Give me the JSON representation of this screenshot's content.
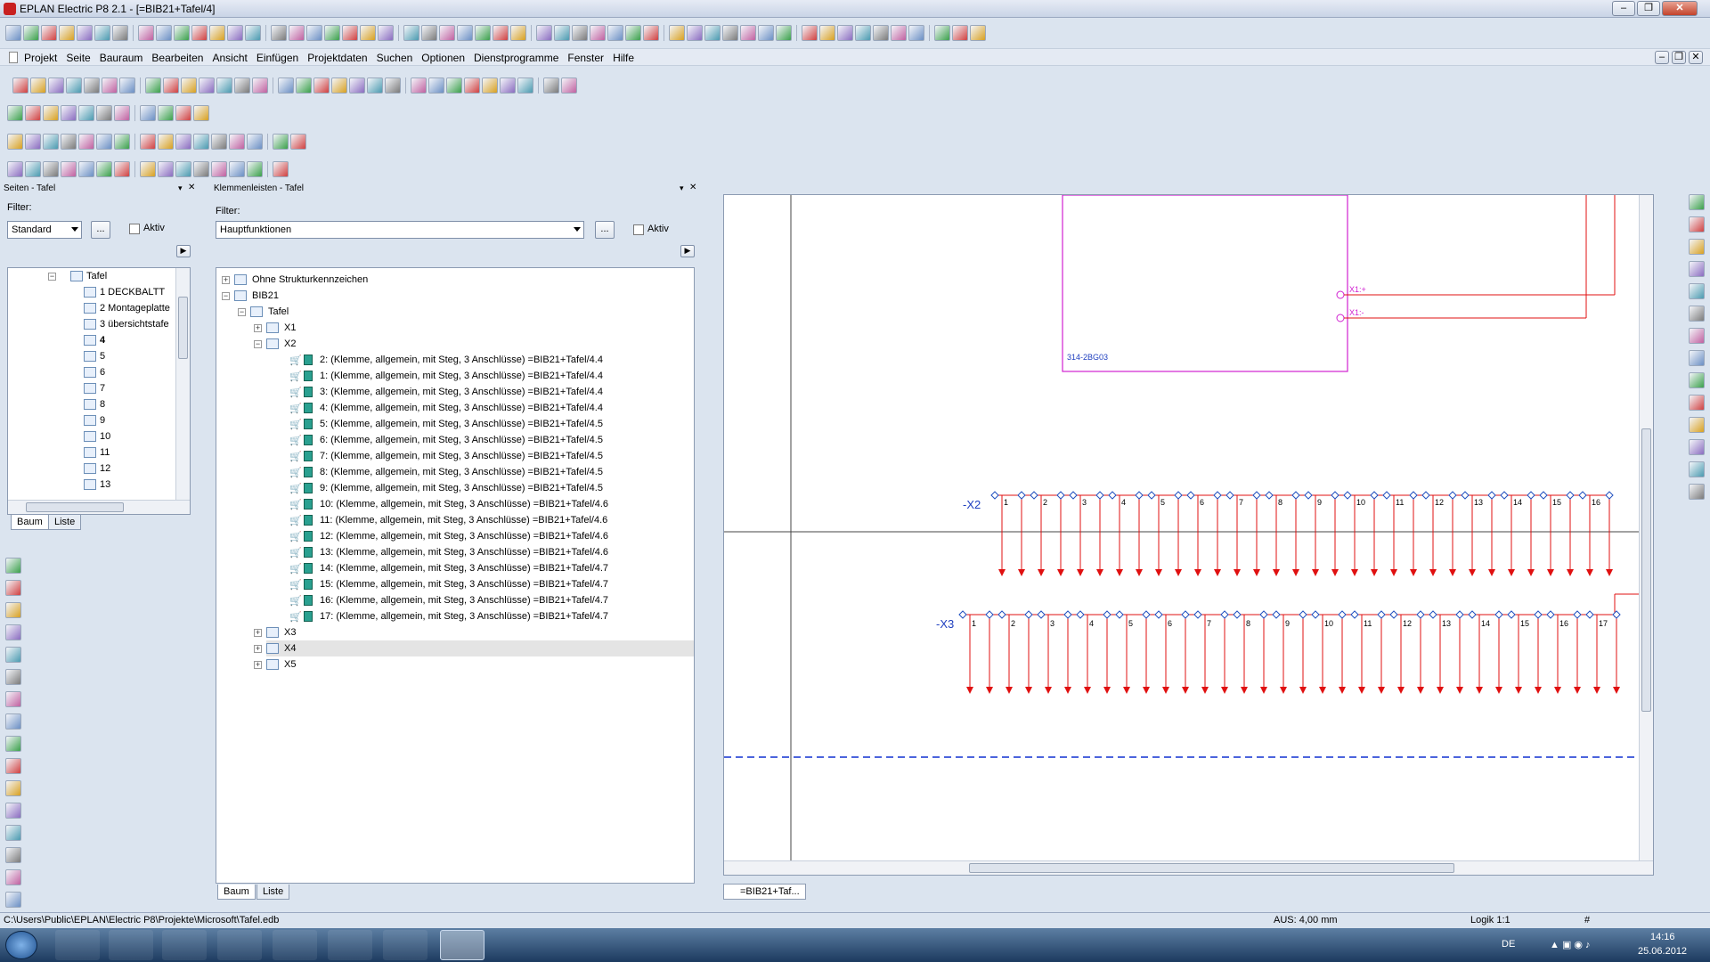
{
  "window": {
    "title": "EPLAN Electric P8 2.1 - [=BIB21+Tafel/4]"
  },
  "menu": [
    "Projekt",
    "Seite",
    "Bauraum",
    "Bearbeiten",
    "Ansicht",
    "Einfügen",
    "Projektdaten",
    "Suchen",
    "Optionen",
    "Dienstprogramme",
    "Fenster",
    "Hilfe"
  ],
  "pages_panel": {
    "title": "Seiten - Tafel",
    "filter_label": "Filter:",
    "filter_value": "Standard",
    "browse_label": "...",
    "active_label": "Aktiv",
    "tree": [
      "Tafel",
      "1 DECKBALTT",
      "2 Montageplatte",
      "3 übersichtstafe",
      "4",
      "5",
      "6",
      "7",
      "8",
      "9",
      "10",
      "11",
      "12",
      "13"
    ],
    "tabs": [
      "Baum",
      "Liste"
    ]
  },
  "terminals_panel": {
    "title": "Klemmenleisten - Tafel",
    "filter_label": "Filter:",
    "filter_value": "Hauptfunktionen",
    "browse_label": "...",
    "active_label": "Aktiv",
    "tree_top": [
      "Ohne Strukturkennzeichen",
      "BIB21",
      "Tafel",
      "X1",
      "X2"
    ],
    "x2_items": [
      "2: (Klemme, allgemein, mit Steg, 3 Anschlüsse) =BIB21+Tafel/4.4",
      "1: (Klemme, allgemein, mit Steg, 3 Anschlüsse) =BIB21+Tafel/4.4",
      "3: (Klemme, allgemein, mit Steg, 3 Anschlüsse) =BIB21+Tafel/4.4",
      "4: (Klemme, allgemein, mit Steg, 3 Anschlüsse) =BIB21+Tafel/4.4",
      "5: (Klemme, allgemein, mit Steg, 3 Anschlüsse) =BIB21+Tafel/4.5",
      "6: (Klemme, allgemein, mit Steg, 3 Anschlüsse) =BIB21+Tafel/4.5",
      "7: (Klemme, allgemein, mit Steg, 3 Anschlüsse) =BIB21+Tafel/4.5",
      "8: (Klemme, allgemein, mit Steg, 3 Anschlüsse) =BIB21+Tafel/4.5",
      "9: (Klemme, allgemein, mit Steg, 3 Anschlüsse) =BIB21+Tafel/4.5",
      "10: (Klemme, allgemein, mit Steg, 3 Anschlüsse) =BIB21+Tafel/4.6",
      "11: (Klemme, allgemein, mit Steg, 3 Anschlüsse) =BIB21+Tafel/4.6",
      "12: (Klemme, allgemein, mit Steg, 3 Anschlüsse) =BIB21+Tafel/4.6",
      "13: (Klemme, allgemein, mit Steg, 3 Anschlüsse) =BIB21+Tafel/4.6",
      "14: (Klemme, allgemein, mit Steg, 3 Anschlüsse) =BIB21+Tafel/4.7",
      "15: (Klemme, allgemein, mit Steg, 3 Anschlüsse) =BIB21+Tafel/4.7",
      "16: (Klemme, allgemein, mit Steg, 3 Anschlüsse) =BIB21+Tafel/4.7",
      "17: (Klemme, allgemein, mit Steg, 3 Anschlüsse) =BIB21+Tafel/4.7"
    ],
    "tree_bottom": [
      "X3",
      "X4",
      "X5"
    ],
    "tabs": [
      "Baum",
      "Liste"
    ]
  },
  "drawing": {
    "tab_label": "=BIB21+Taf...",
    "device_label": "314-2BG03",
    "pin_plus": "X1:+",
    "pin_minus": "X1:-",
    "strip_x2": "-X2",
    "strip_x3": "-X3",
    "x2_numbers": [
      "1",
      "2",
      "3",
      "4",
      "5",
      "6",
      "7",
      "8",
      "9",
      "10",
      "11",
      "12",
      "13",
      "14",
      "15",
      "16"
    ],
    "x3_numbers": [
      "1",
      "2",
      "3",
      "4",
      "5",
      "6",
      "7",
      "8",
      "9",
      "10",
      "11",
      "12",
      "13",
      "14",
      "15",
      "16",
      "17"
    ],
    "colors": {
      "wire": "#e01010",
      "device": "#d020d0",
      "terminal": "#2050c0",
      "label": "#2040c0"
    }
  },
  "status": {
    "path": "C:\\Users\\Public\\EPLAN\\Electric P8\\Projekte\\Microsoft\\Tafel.edb",
    "aus": "AUS: 4,00 mm",
    "logic": "Logik 1:1",
    "hash": "#"
  },
  "taskbar": {
    "lang": "DE",
    "time": "14:16",
    "date": "25.06.2012"
  }
}
